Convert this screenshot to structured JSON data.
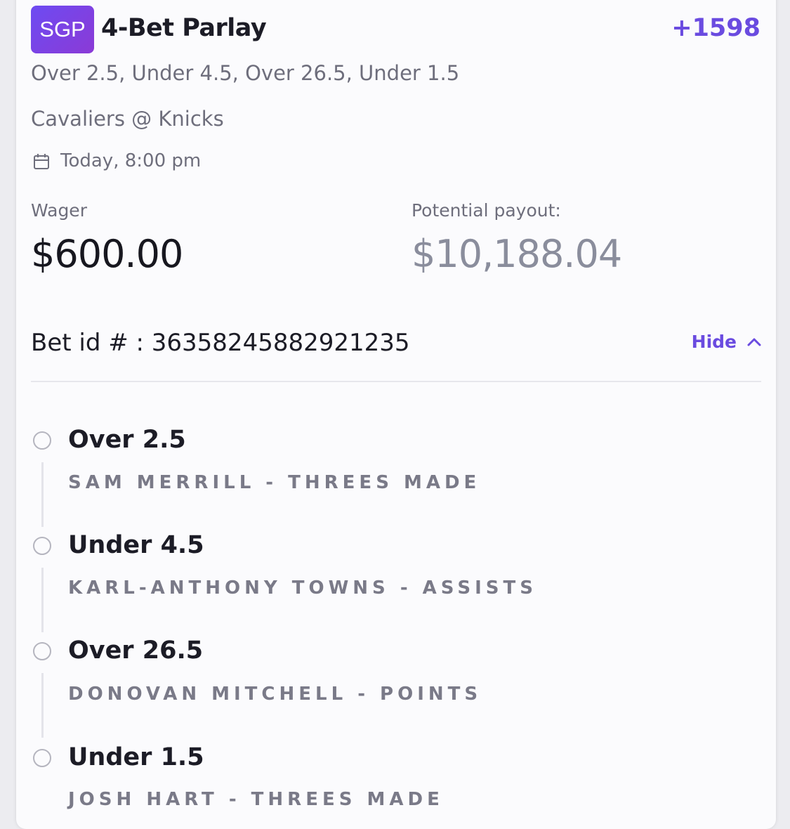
{
  "bet": {
    "badge": "SGP",
    "title": "4-Bet Parlay",
    "odds": "+1598",
    "selections_summary": "Over 2.5, Under 4.5, Over 26.5, Under 1.5",
    "matchup": "Cavaliers @ Knicks",
    "datetime": "Today, 8:00 pm",
    "wager_label": "Wager",
    "wager_value": "$600.00",
    "payout_label": "Potential payout:",
    "payout_value": "$10,188.04",
    "bet_id_text": "Bet id # : 36358245882921235",
    "hide_label": "Hide"
  },
  "legs": [
    {
      "selection": "Over 2.5",
      "market": "SAM MERRILL - THREES MADE"
    },
    {
      "selection": "Under 4.5",
      "market": "KARL-ANTHONY TOWNS - ASSISTS"
    },
    {
      "selection": "Over 26.5",
      "market": "DONOVAN MITCHELL - POINTS"
    },
    {
      "selection": "Under 1.5",
      "market": "JOSH HART - THREES MADE"
    }
  ]
}
